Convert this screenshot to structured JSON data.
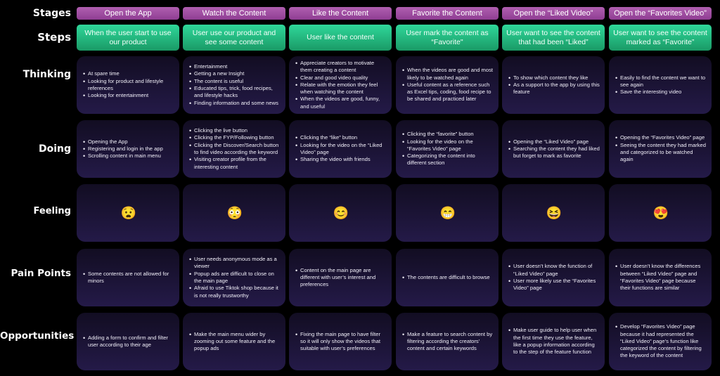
{
  "row_labels": {
    "stages": "Stages",
    "steps": "Steps",
    "thinking": "Thinking",
    "doing": "Doing",
    "feeling": "Feeling",
    "pain_points": "Pain Points",
    "opportunities": "Opportunities"
  },
  "colors": {
    "stage_header": "#9f4ea3",
    "step_header": "#22c080",
    "card_bg": "#1b1436",
    "page_bg": "#000000"
  },
  "stages": [
    "Open the App",
    "Watch the Content",
    "Like the Content",
    "Favorite the Content",
    "Open the “Liked Video”",
    "Open the “Favorites Video”"
  ],
  "steps": [
    "When the user start to use our product",
    "User use our product and see some content",
    "User like the content",
    "User mark the content as “Favorite\"",
    "User want to see the content that had been “Liked”",
    "User want to see the content marked as “Favorite”"
  ],
  "thinking": [
    [
      "At spare time",
      "Looking for product and lifestyle references",
      "Looking for entertainment"
    ],
    [
      "Entertainment",
      "Getting a new Insight",
      "The content is useful",
      "Educated tips, trick, food recipes, and lifestyle hacks",
      "Finding information and some news"
    ],
    [
      "Appreciate creators to motivate them creating a content",
      "Clear and good video quality",
      "Relate with the emotion they feel when watching the content",
      "When the videos are good, funny, and useful"
    ],
    [
      "When the videos are good and most likely to be watched again",
      "Useful content as a reference such as Excel tips, coding, food recipe to be shared and practiced later"
    ],
    [
      "To show which content they like",
      "As a support to the app by using this feature"
    ],
    [
      "Easily to find the content we want to see again",
      "Save the interesting video"
    ]
  ],
  "doing": [
    [
      "Opening the App",
      "Registering and login in the app",
      "Scrolling content in main menu"
    ],
    [
      "Clicking the live button",
      "Clicking the FYP/Following button",
      "Clicking the Discover/Search button to find video according the keyword",
      "Visiting creator profile from the interesting content"
    ],
    [
      "Clicking the “like” button",
      "Looking for the video on the “Liked Video” page",
      "Sharing the video with friends"
    ],
    [
      "Clicking the “favorite” button",
      "Looking for the video on the “Favorites Video” page",
      "Categorizing the content into different section"
    ],
    [
      "Opening the “Liked Video” page",
      "Searching the content they had liked but forget to mark as favorite"
    ],
    [
      "Opening the “Favorites Video” page",
      "Seeing the content they had marked and categorized to be watched again"
    ]
  ],
  "feeling": [
    {
      "icon": "frowning-open-mouth-face-icon",
      "glyph": "😧"
    },
    {
      "icon": "flushed-astonished-face-icon",
      "glyph": "😳"
    },
    {
      "icon": "smiling-blushing-face-icon",
      "glyph": "😊"
    },
    {
      "icon": "beaming-grin-face-icon",
      "glyph": "😁"
    },
    {
      "icon": "squinting-laughing-face-icon",
      "glyph": "😆"
    },
    {
      "icon": "heart-eyes-face-icon",
      "glyph": "😍"
    }
  ],
  "pain_points": [
    [
      "Some contents are not allowed for minors"
    ],
    [
      "User needs anonymous mode as a viewer",
      "Popup ads are difficult to close on the main page",
      "Afraid to use Tiktok shop because it is not really trustworthy"
    ],
    [
      "Content on the main page are different with user’s interest and preferences"
    ],
    [
      "The contents are difficult to browse"
    ],
    [
      "User doesn’t know the function of “Liked Video” page",
      "User more likely use the “Favorites Video” page"
    ],
    [
      "User doesn’t know the differences between “Liked Video” page and “Favorites Video” page because their functions are similar"
    ]
  ],
  "opportunities": [
    [
      "Adding a form to confirm and filter user according to their age"
    ],
    [
      "Make the main menu wider by zooming out some feature and the popup ads"
    ],
    [
      "Fixing the main page to have filter so it will only show the videos that suitable with user’s preferences"
    ],
    [
      "Make a feature to search content by filtering according the creators’ content and certain keywords"
    ],
    [
      "Make user guide to help user when the first time they use the feature, like a popup information according to the step of the feature function"
    ],
    [
      "Develop “Favorites Video” page because it had represented the “Liked Video” page’s function like categorized the content by filtering the keyword of the content"
    ]
  ]
}
